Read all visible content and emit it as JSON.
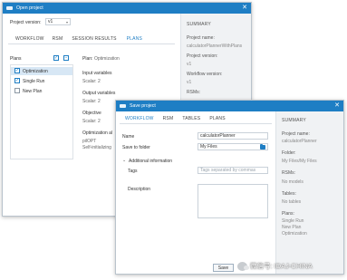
{
  "open_dialog": {
    "title": "Open project",
    "project_version_label": "Project version:",
    "project_version_value": "v1",
    "tabs": [
      {
        "label": "WORKFLOW",
        "active": false
      },
      {
        "label": "RSM",
        "active": false
      },
      {
        "label": "SESSION RESULTS",
        "active": false
      },
      {
        "label": "PLANS",
        "active": true
      }
    ],
    "plans_header": "Plans",
    "plans": [
      {
        "label": "Optimization",
        "checked": true,
        "selected": true
      },
      {
        "label": "Single Run",
        "checked": true,
        "selected": false
      },
      {
        "label": "New Plan",
        "checked": false,
        "selected": false
      }
    ],
    "detail": {
      "plan_label": "Plan:",
      "plan_value": "Optimization",
      "input_label": "Input variables",
      "input_value": "Scalar: 2",
      "output_label": "Output variables",
      "output_value": "Scalar: 2",
      "objective_label": "Objective",
      "objective_value": "Scalar: 2",
      "opt_alg_label": "Optimization al",
      "opt_alg_v1": "pilOPT",
      "opt_alg_v2": "Self-initializing"
    },
    "summary": {
      "header": "SUMMARY",
      "project_name_label": "Project name:",
      "project_name_value": "calculatorPlannerWithPlans",
      "project_version_label": "Project version:",
      "project_version_value": "v1",
      "workflow_version_label": "Workflow version:",
      "workflow_version_value": "v1",
      "rsms_label": "RSMs:"
    }
  },
  "save_dialog": {
    "title": "Save project",
    "tabs": [
      {
        "label": "WORKFLOW",
        "active": true
      },
      {
        "label": "RSM",
        "active": false
      },
      {
        "label": "TABLES",
        "active": false
      },
      {
        "label": "PLANS",
        "active": false
      }
    ],
    "name_label": "Name",
    "name_value": "calculatorPlanner",
    "folder_label": "Save to folder",
    "folder_value": "My Files",
    "additional_label": "Additional information",
    "tags_label": "Tags",
    "tags_placeholder": "Tags separated by commas",
    "description_label": "Description",
    "save_button": "Save",
    "summary": {
      "header": "SUMMARY",
      "project_name_label": "Project name:",
      "project_name_value": "calculatorPlanner",
      "folder_label": "Folder:",
      "folder_value": "My Files/My Files",
      "rsms_label": "RSMs:",
      "rsms_value": "No models",
      "tables_label": "Tables:",
      "tables_value": "No tables",
      "plans_label": "Plans:",
      "plans_values": [
        "Single Run",
        "New Plan",
        "Optimization"
      ]
    }
  },
  "watermark": "微信号: IDAJ-CHINA",
  "colors": {
    "title_bar": "#1e7ec4",
    "accent": "#1e7ec4",
    "summary_bg": "#f0f2f4"
  }
}
